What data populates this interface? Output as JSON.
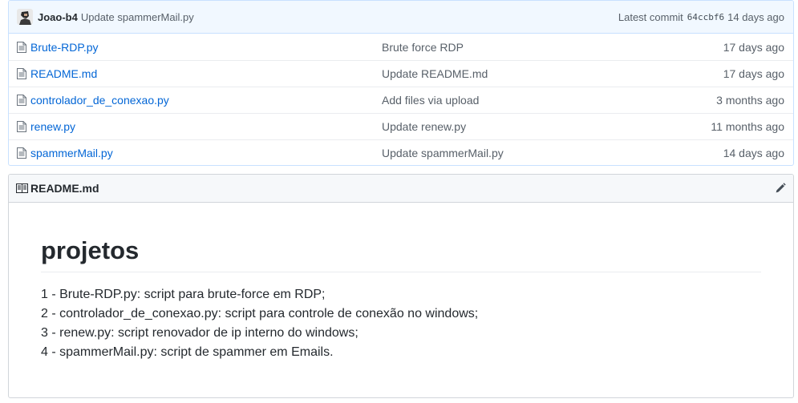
{
  "commit": {
    "author": "Joao-b4",
    "message": "Update spammerMail.py",
    "latest_label": "Latest commit",
    "sha": "64ccbf6",
    "age": "14 days ago"
  },
  "files": [
    {
      "name": "Brute-RDP.py",
      "message": "Brute force RDP",
      "age": "17 days ago"
    },
    {
      "name": "README.md",
      "message": "Update README.md",
      "age": "17 days ago"
    },
    {
      "name": "controlador_de_conexao.py",
      "message": "Add files via upload",
      "age": "3 months ago"
    },
    {
      "name": "renew.py",
      "message": "Update renew.py",
      "age": "11 months ago"
    },
    {
      "name": "spammerMail.py",
      "message": "Update spammerMail.py",
      "age": "14 days ago"
    }
  ],
  "readme": {
    "filename": "README.md",
    "heading": "projetos",
    "lines": [
      "1 - Brute-RDP.py: script para brute-force em RDP;",
      "2 - controlador_de_conexao.py: script para controle de conexão no windows;",
      "3 - renew.py: script renovador de ip interno do windows;",
      "4 - spammerMail.py: script de spammer em Emails."
    ]
  },
  "icons": {
    "file": "file-text-icon",
    "book": "book-icon",
    "edit": "pencil-icon"
  },
  "colors": {
    "link": "#0366d6",
    "commit_bar_bg": "#f1f8ff",
    "commit_bar_border": "#c8e1ff",
    "muted_text": "#586069"
  }
}
